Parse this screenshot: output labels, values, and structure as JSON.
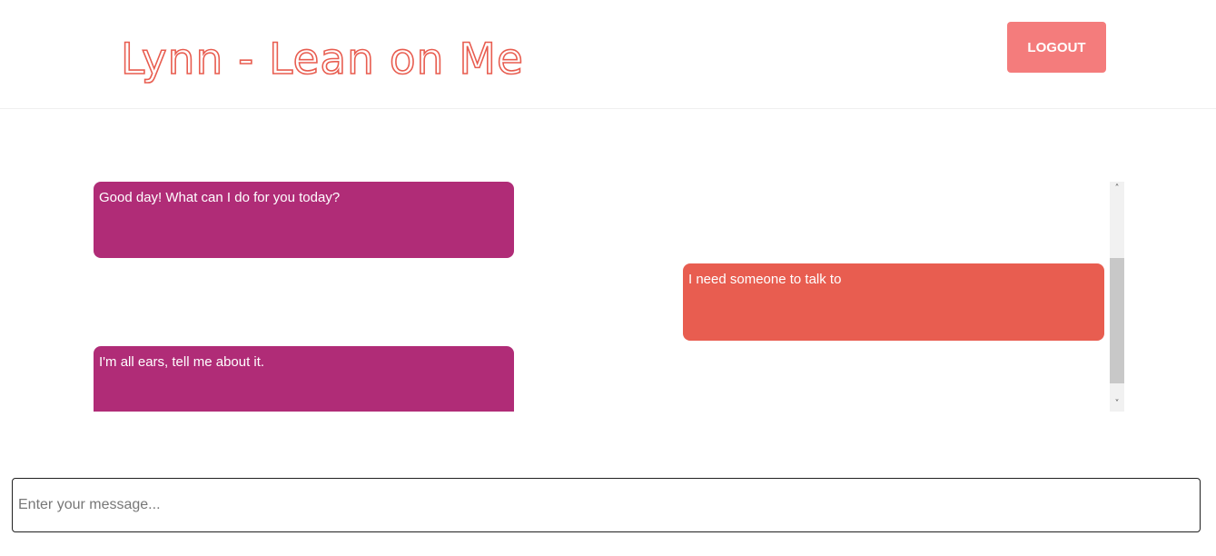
{
  "header": {
    "title": "Lynn - Lean on Me",
    "logout_label": "LOGOUT"
  },
  "chat": {
    "messages": [
      {
        "sender": "bot",
        "text": "Good day! What can I do for you today?"
      },
      {
        "sender": "user",
        "text": "I need someone to talk to"
      },
      {
        "sender": "bot",
        "text": "I'm all ears, tell me about it."
      }
    ]
  },
  "composer": {
    "placeholder": "Enter your message...",
    "value": ""
  },
  "colors": {
    "brand": "#e85d50",
    "bot_bubble": "#b02c77",
    "user_bubble": "#e85d50",
    "logout_button": "#f47c7c"
  },
  "icons": {
    "scroll_up": "chevron-up-icon",
    "scroll_down": "chevron-down-icon"
  }
}
